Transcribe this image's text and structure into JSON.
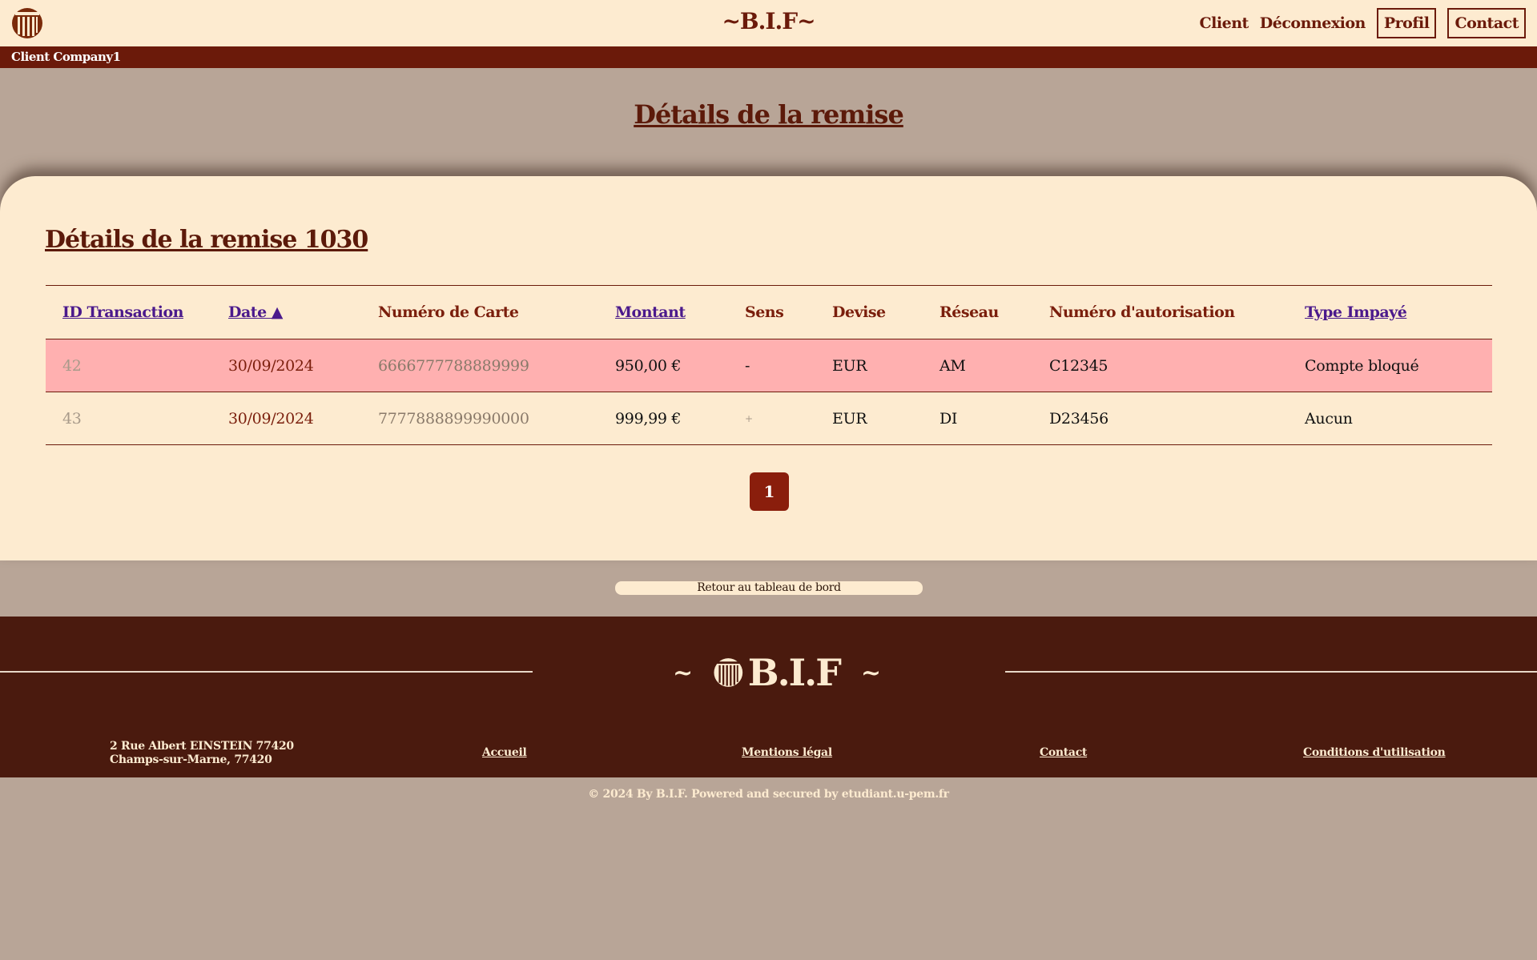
{
  "header": {
    "brand": "~B.I.F~",
    "nav": {
      "client": "Client",
      "logout": "Déconnexion",
      "profile": "Profil",
      "contact": "Contact"
    }
  },
  "client_bar": {
    "label": "Client Company1"
  },
  "page_title": "Détails de la remise",
  "card": {
    "title": "Détails de la remise 1030",
    "table": {
      "headers": {
        "id": "ID Transaction",
        "date": "Date ▲",
        "card": "Numéro de Carte",
        "amount": "Montant",
        "direction": "Sens",
        "currency": "Devise",
        "network": "Réseau",
        "auth": "Numéro d'autorisation",
        "unpaid_type": "Type Impayé"
      },
      "rows": [
        {
          "id": "42",
          "date": "30/09/2024",
          "card": "6666777788889999",
          "amount": "950,00 €",
          "direction": "-",
          "currency": "EUR",
          "network": "AM",
          "auth": "C12345",
          "unpaid_type": "Compte bloqué"
        },
        {
          "id": "43",
          "date": "30/09/2024",
          "card": "7777888899990000",
          "amount": "999,99 €",
          "direction": "+",
          "currency": "EUR",
          "network": "DI",
          "auth": "D23456",
          "unpaid_type": "Aucun"
        }
      ]
    },
    "pagination": {
      "current": "1"
    }
  },
  "back_button": "Retour au tableau de bord",
  "footer": {
    "tilde_left": "~",
    "brand": "B.I.F",
    "tilde_right": "~",
    "address_line1": "2 Rue Albert EINSTEIN 77420",
    "address_line2": "Champs-sur-Marne, 77420",
    "links": {
      "home": "Accueil",
      "legal": "Mentions légal",
      "contact": "Contact",
      "terms": "Conditions d'utilisation"
    }
  },
  "copyright": "© 2024 By B.I.F. Powered and secured by etudiant.u-pem.fr",
  "colors": {
    "brand_dark": "#6b1a0a",
    "cream": "#fdebd0",
    "background": "#b8a597",
    "unpaid_row": "#ffb0b0",
    "link_purple": "#4b1a8c"
  }
}
